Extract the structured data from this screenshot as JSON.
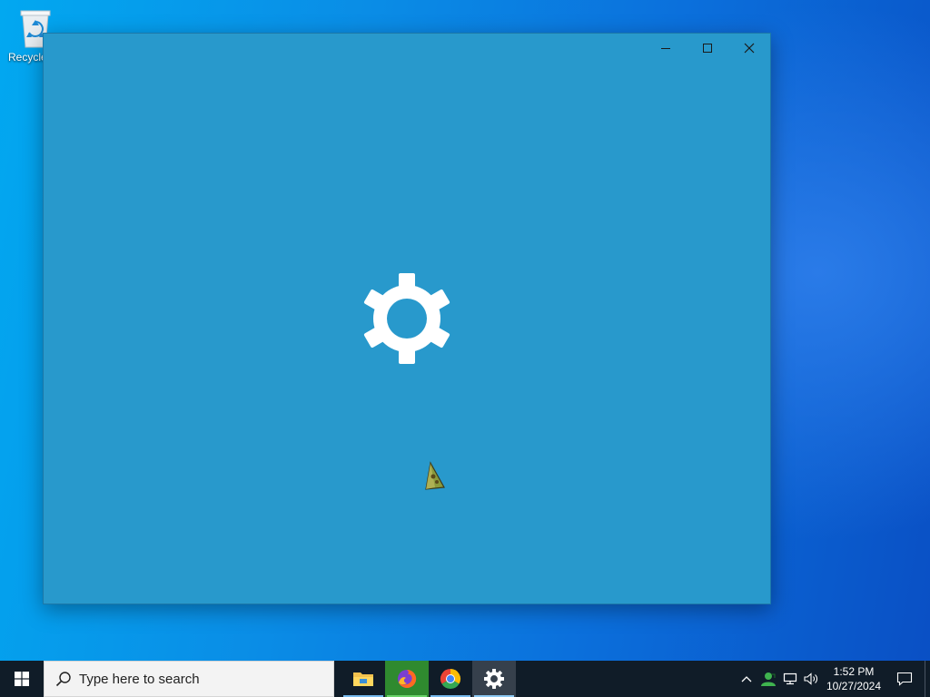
{
  "desktop": {
    "icons": [
      {
        "label": "Recycle Bin"
      }
    ]
  },
  "window": {
    "background_color": "#2899cc",
    "controls": {
      "minimize": "minimize-icon",
      "maximize": "maximize-icon",
      "close": "close-icon"
    },
    "splash_icon": "gear-icon"
  },
  "taskbar": {
    "search": {
      "placeholder": "Type here to search"
    },
    "apps": [
      {
        "name": "File Explorer",
        "icon": "folder-icon"
      },
      {
        "name": "Firefox",
        "icon": "firefox-icon"
      },
      {
        "name": "Google Chrome",
        "icon": "chrome-icon"
      },
      {
        "name": "Settings",
        "icon": "gear-icon"
      }
    ],
    "tray": {
      "time": "1:52 PM",
      "date": "10/27/2024"
    }
  }
}
